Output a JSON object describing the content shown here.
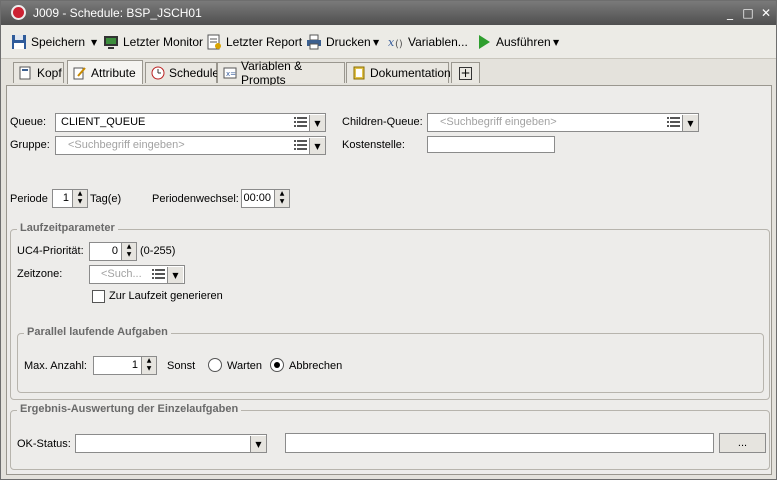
{
  "window": {
    "title": "J009 - Schedule: BSP_JSCH01"
  },
  "toolbar": {
    "save": "Speichern",
    "last_monitor": "Letzter Monitor",
    "last_report": "Letzter Report",
    "print": "Drucken",
    "variables": "Variablen...",
    "execute": "Ausführen"
  },
  "tabs": {
    "kopf": "Kopf",
    "attribute": "Attribute",
    "schedule": "Schedule",
    "variables_prompts": "Variablen & Prompts",
    "documentation": "Dokumentation"
  },
  "form": {
    "queue_label": "Queue:",
    "queue_value": "CLIENT_QUEUE",
    "group_label": "Gruppe:",
    "group_placeholder": "<Suchbegriff eingeben>",
    "children_queue_label": "Children-Queue:",
    "children_queue_placeholder": "<Suchbegriff eingeben>",
    "cost_center_label": "Kostenstelle:",
    "cost_center_value": "",
    "period_label": "Periode",
    "period_value": "1",
    "period_unit": "Tag(e)",
    "period_change_label": "Periodenwechsel:",
    "period_change_value": "00:00"
  },
  "runtime": {
    "legend": "Laufzeitparameter",
    "priority_label": "UC4-Priorität:",
    "priority_value": "0",
    "priority_range": "(0-255)",
    "timezone_label": "Zeitzone:",
    "timezone_placeholder": "<Such...",
    "generate_label": "Zur Laufzeit generieren"
  },
  "parallel": {
    "legend": "Parallel laufende Aufgaben",
    "max_label": "Max. Anzahl:",
    "max_value": "1",
    "else_label": "Sonst",
    "wait_label": "Warten",
    "abort_label": "Abbrechen",
    "selected": "Abbrechen"
  },
  "result": {
    "legend": "Ergebnis-Auswertung der Einzelaufgaben",
    "ok_status_label": "OK-Status:",
    "ok_status_value": "",
    "text_value": "",
    "browse_label": "..."
  }
}
